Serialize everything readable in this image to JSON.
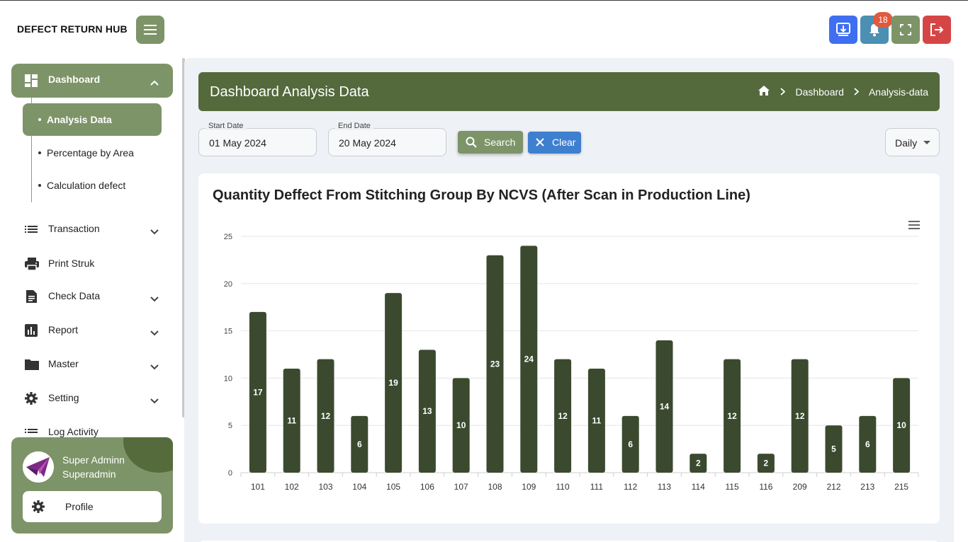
{
  "app": {
    "title": "DEFECT RETURN HUB"
  },
  "topbar": {
    "notification_count": "18"
  },
  "sidebar": {
    "dashboard": {
      "label": "Dashboard",
      "icon": "dashboard-icon"
    },
    "sub_items": [
      {
        "label": "Analysis Data",
        "active": true
      },
      {
        "label": "Percentage by Area",
        "active": false
      },
      {
        "label": "Calculation defect",
        "active": false
      }
    ],
    "items": [
      {
        "label": "Transaction",
        "icon": "list-icon",
        "expandable": true
      },
      {
        "label": "Print Struk",
        "icon": "printer-icon",
        "expandable": false
      },
      {
        "label": "Check Data",
        "icon": "document-icon",
        "expandable": true
      },
      {
        "label": "Report",
        "icon": "bar-chart-icon",
        "expandable": true
      },
      {
        "label": "Master",
        "icon": "folder-icon",
        "expandable": true
      },
      {
        "label": "Setting",
        "icon": "gear-icon",
        "expandable": true
      },
      {
        "label": "Log Activity",
        "icon": "list-icon",
        "expandable": false
      }
    ]
  },
  "profile": {
    "name": "Super Adminn",
    "role": "Superadmin",
    "button_label": "Profile"
  },
  "header": {
    "title": "Dashboard Analysis Data",
    "breadcrumb": [
      "Dashboard",
      "Analysis-data"
    ]
  },
  "filters": {
    "start_date_label": "Start Date",
    "start_date_value": "01 May 2024",
    "end_date_label": "End Date",
    "end_date_value": "20 May 2024",
    "search_label": "Search",
    "clear_label": "Clear",
    "period_value": "Daily"
  },
  "colors": {
    "accent": "#7d9468",
    "header": "#546a3c",
    "bar": "#3b4a2f",
    "search": "#7d9468",
    "clear": "#3f7fcf"
  },
  "chart_data": {
    "type": "bar",
    "title": "Quantity Deffect From Stitching Group By NCVS (After Scan in Production Line)",
    "categories": [
      "101",
      "102",
      "103",
      "104",
      "105",
      "106",
      "107",
      "108",
      "109",
      "110",
      "111",
      "112",
      "113",
      "114",
      "115",
      "116",
      "209",
      "212",
      "213",
      "215"
    ],
    "values": [
      17,
      11,
      12,
      6,
      19,
      13,
      10,
      23,
      24,
      12,
      11,
      6,
      14,
      2,
      12,
      2,
      12,
      5,
      6,
      10
    ],
    "yticks": [
      "0",
      "5",
      "10",
      "15",
      "20",
      "25"
    ],
    "ylim": [
      0,
      25
    ],
    "grid": true,
    "data_labels": true
  }
}
